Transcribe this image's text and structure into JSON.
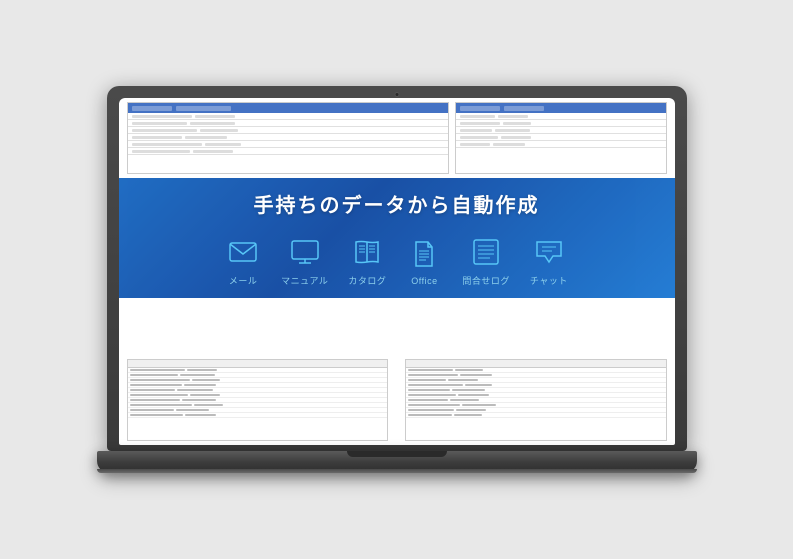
{
  "page": {
    "background": "#e8e8e8"
  },
  "banner": {
    "title": "手持ちのデータから自動作成"
  },
  "icons": [
    {
      "id": "mail",
      "label": "メール",
      "icon": "mail"
    },
    {
      "id": "manual",
      "label": "マニュアル",
      "icon": "monitor"
    },
    {
      "id": "catalog",
      "label": "カタログ",
      "icon": "book"
    },
    {
      "id": "office",
      "label": "Office",
      "icon": "document"
    },
    {
      "id": "inquiry",
      "label": "問合せログ",
      "icon": "list"
    },
    {
      "id": "chat",
      "label": "チャット",
      "icon": "chat"
    }
  ]
}
